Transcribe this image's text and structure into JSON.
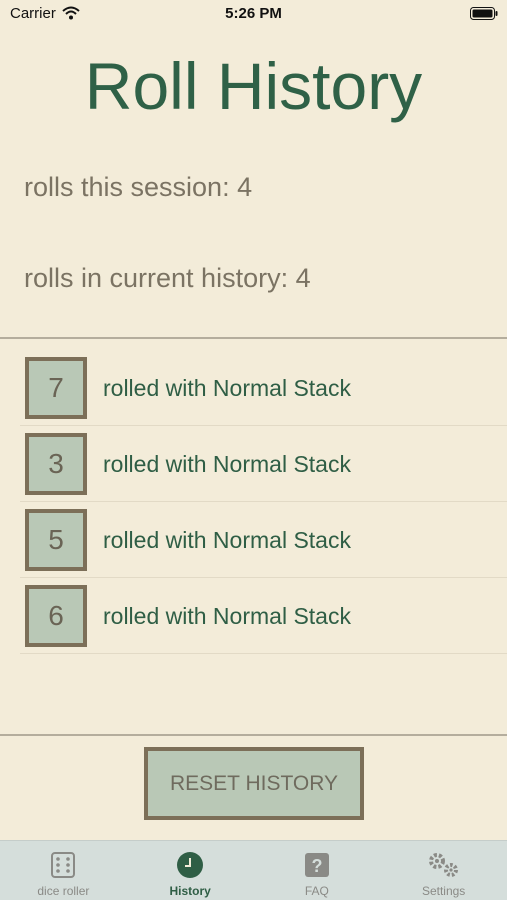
{
  "status_bar": {
    "carrier": "Carrier",
    "time": "5:26 PM"
  },
  "title": "Roll History",
  "stats": {
    "session": "rolls this session: 4",
    "history": "rolls in current history: 4"
  },
  "history": [
    {
      "value": "7",
      "text": "rolled with Normal Stack"
    },
    {
      "value": "3",
      "text": "rolled with Normal Stack"
    },
    {
      "value": "5",
      "text": "rolled with Normal Stack"
    },
    {
      "value": "6",
      "text": "rolled with Normal Stack"
    }
  ],
  "reset_button": "RESET HISTORY",
  "tabs": [
    {
      "label": "dice roller",
      "icon": "dice-icon",
      "active": false
    },
    {
      "label": "History",
      "icon": "clock-icon",
      "active": true
    },
    {
      "label": "FAQ",
      "icon": "question-icon",
      "active": false
    },
    {
      "label": "Settings",
      "icon": "gears-icon",
      "active": false
    }
  ],
  "colors": {
    "background": "#f3ecd9",
    "accent_green": "#2f6147",
    "die_fill": "#b9c8b6",
    "die_border": "#7c6f58",
    "tab_bar": "#d5dedb"
  }
}
